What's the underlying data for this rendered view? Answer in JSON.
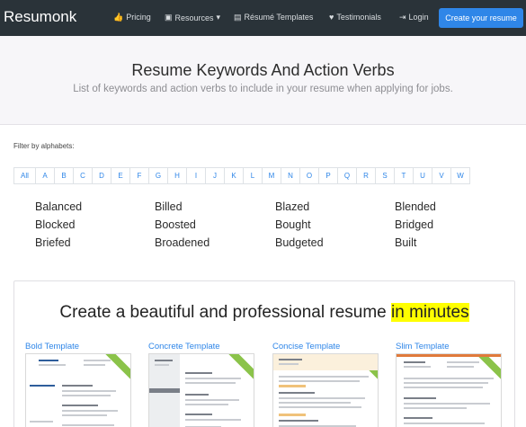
{
  "nav": {
    "brand": "Resumonk",
    "items": [
      {
        "label": "Pricing",
        "icon": "thumbs-up-icon",
        "glyph": "👍"
      },
      {
        "label": "Resources",
        "icon": "briefcase-icon",
        "glyph": "▣",
        "caret": "▾"
      },
      {
        "label": "Résumé Templates",
        "icon": "document-icon",
        "glyph": "▤"
      },
      {
        "label": "Testimonials",
        "icon": "heart-icon",
        "glyph": "♥"
      },
      {
        "label": "Login",
        "icon": "sign-in-icon",
        "glyph": "⇥"
      }
    ],
    "cta": "Create your resume"
  },
  "hero": {
    "title": "Resume Keywords And Action Verbs",
    "subtitle": "List of keywords and action verbs to include in your resume when applying for jobs."
  },
  "filter": {
    "label": "Filter by alphabets:",
    "letters": [
      "All",
      "A",
      "B",
      "C",
      "D",
      "E",
      "F",
      "G",
      "H",
      "I",
      "J",
      "K",
      "L",
      "M",
      "N",
      "O",
      "P",
      "Q",
      "R",
      "S",
      "T",
      "U",
      "V",
      "W"
    ]
  },
  "keywords": [
    [
      "Balanced",
      "Billed",
      "Blazed",
      "Blended"
    ],
    [
      "Blocked",
      "Boosted",
      "Bought",
      "Bridged"
    ],
    [
      "Briefed",
      "Broadened",
      "Budgeted",
      "Built"
    ]
  ],
  "promo": {
    "title_plain": "Create a beautiful and professional resume ",
    "title_highlight": "in minutes",
    "highlight_color": "#ffff00",
    "templates": [
      "Bold Template",
      "Concrete Template",
      "Concise Template",
      "Slim Template"
    ]
  },
  "colors": {
    "navbar": "#2a3339",
    "accent": "#2f86e8",
    "ribbon": "#8bc34a"
  }
}
